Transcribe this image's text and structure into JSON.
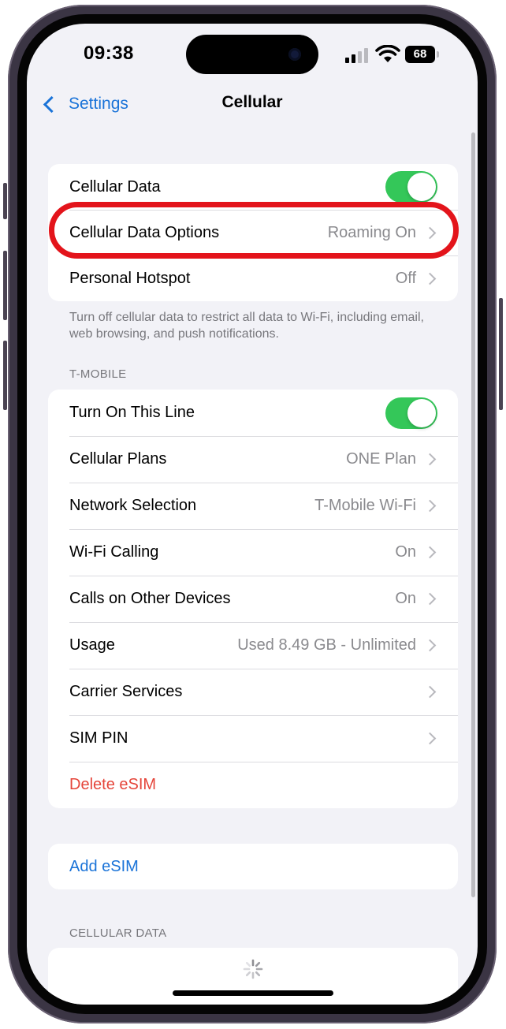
{
  "status_bar": {
    "time": "09:38",
    "battery": "68"
  },
  "nav": {
    "back_label": "Settings",
    "title": "Cellular"
  },
  "group1": {
    "rows": [
      {
        "label": "Cellular Data"
      },
      {
        "label": "Cellular Data Options",
        "value": "Roaming On"
      },
      {
        "label": "Personal Hotspot",
        "value": "Off"
      }
    ],
    "footer": "Turn off cellular data to restrict all data to Wi-Fi, including email, web browsing, and push notifications."
  },
  "tmobile": {
    "header": "T-MOBILE",
    "rows": [
      {
        "label": "Turn On This Line"
      },
      {
        "label": "Cellular Plans",
        "value": "ONE Plan"
      },
      {
        "label": "Network Selection",
        "value": "T-Mobile Wi-Fi"
      },
      {
        "label": "Wi-Fi Calling",
        "value": "On"
      },
      {
        "label": "Calls on Other Devices",
        "value": "On"
      },
      {
        "label": "Usage",
        "value": "Used 8.49 GB - Unlimited"
      },
      {
        "label": "Carrier Services"
      },
      {
        "label": "SIM PIN"
      },
      {
        "label": "Delete eSIM"
      }
    ]
  },
  "add_esim": {
    "label": "Add eSIM"
  },
  "cellular_data_section": {
    "header": "CELLULAR DATA"
  },
  "colors": {
    "accent": "#1a73d8",
    "toggle_on": "#34c759",
    "destructive": "#e5453a",
    "highlight": "#e3141b"
  }
}
